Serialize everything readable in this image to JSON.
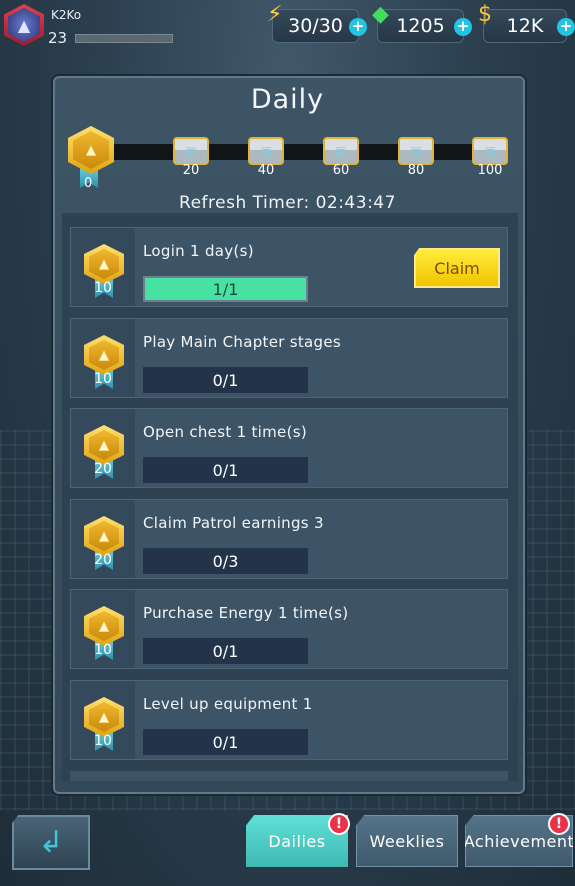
{
  "player": {
    "name": "K2Ko",
    "level": "23"
  },
  "resources": {
    "energy": {
      "value": "30/30",
      "icon": "lightning-icon"
    },
    "gems": {
      "value": "1205",
      "icon": "gem-icon"
    },
    "cash": {
      "value": "12K",
      "icon": "cash-icon"
    }
  },
  "panel": {
    "title": "Daily",
    "points": "0",
    "milestones": [
      "20",
      "40",
      "60",
      "80",
      "100"
    ],
    "refresh_timer": "Refresh Timer: 02:43:47"
  },
  "quests": [
    {
      "title": "Login 1 day(s)",
      "reward": "10",
      "progress": "1/1",
      "completed": true,
      "claim_label": "Claim"
    },
    {
      "title": "Play Main Chapter stages",
      "reward": "10",
      "progress": "0/1",
      "completed": false
    },
    {
      "title": "Open chest 1 time(s)",
      "reward": "20",
      "progress": "0/1",
      "completed": false
    },
    {
      "title": "Claim Patrol earnings 3",
      "reward": "20",
      "progress": "0/3",
      "completed": false
    },
    {
      "title": "Purchase Energy 1 time(s)",
      "reward": "10",
      "progress": "0/1",
      "completed": false
    },
    {
      "title": "Level up equipment 1",
      "reward": "10",
      "progress": "0/1",
      "completed": false
    }
  ],
  "tabs": {
    "dailies": "Dailies",
    "weeklies": "Weeklies",
    "achievement": "Achievement",
    "alert_mark": "!"
  },
  "colors": {
    "accent": "#3fb9b2",
    "claim": "#f2c300",
    "progress_done": "#47e2a3",
    "alert": "#e8334a"
  }
}
